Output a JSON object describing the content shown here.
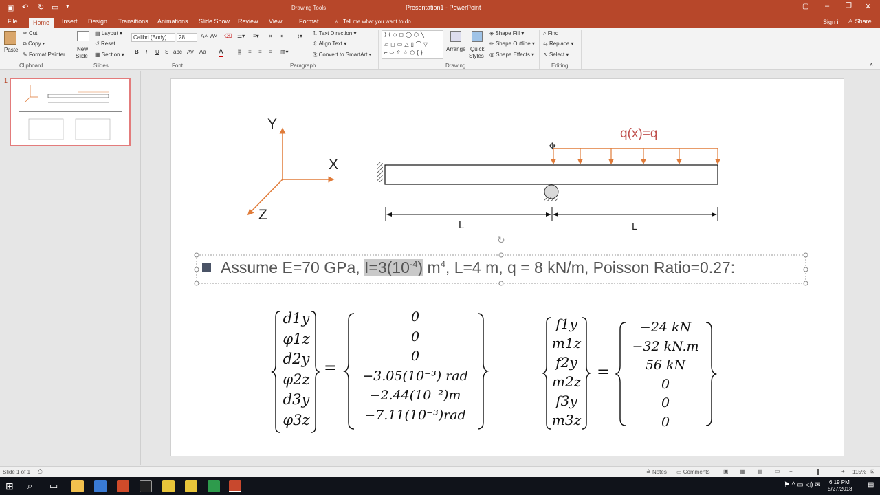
{
  "titlebar": {
    "title": "Presentation1 - PowerPoint",
    "context_label": "Drawing Tools"
  },
  "tabs": [
    "File",
    "Home",
    "Insert",
    "Design",
    "Transitions",
    "Animations",
    "Slide Show",
    "Review",
    "View",
    "Format"
  ],
  "tell_me": "Tell me what you want to do...",
  "account": {
    "signin": "Sign in",
    "share": "Share"
  },
  "ribbon": {
    "clipboard": {
      "label": "Clipboard",
      "paste": "Paste",
      "cut": "Cut",
      "copy": "Copy",
      "format_painter": "Format Painter"
    },
    "slides": {
      "label": "Slides",
      "new_slide": "New",
      "new_slide2": "Slide",
      "layout": "Layout",
      "reset": "Reset",
      "section": "Section"
    },
    "font": {
      "label": "Font",
      "font_name": "Calibri (Body)",
      "font_size": "28"
    },
    "paragraph": {
      "label": "Paragraph",
      "text_direction": "Text Direction",
      "align_text": "Align Text",
      "convert": "Convert to SmartArt"
    },
    "drawing": {
      "label": "Drawing",
      "arrange": "Arrange",
      "quick_styles": "Quick",
      "quick_styles2": "Styles",
      "shape_fill": "Shape Fill",
      "shape_outline": "Shape Outline",
      "shape_effects": "Shape Effects"
    },
    "editing": {
      "label": "Editing",
      "find": "Find",
      "replace": "Replace",
      "select": "Select"
    }
  },
  "thumbnail": {
    "number": "1"
  },
  "slide": {
    "axes": {
      "y": "Y",
      "x": "X",
      "z": "Z"
    },
    "load_label": "q(x)=q",
    "dim_left": "L",
    "dim_right": "L",
    "bullet_text_pre": "Assume E=70 GPa, ",
    "bullet_text_highlight": "I=3(10",
    "bullet_exp_highlight": "-4",
    "bullet_text_highlight_end": ")",
    "bullet_text_mid": " m",
    "bullet_exp": "4",
    "bullet_text_post": ", L=4 m, q = 8 kN/m, Poisson Ratio=0.27:",
    "eq1_lhs": [
      "d1y",
      "φ1z",
      "d2y",
      "φ2z",
      "d3y",
      "φ3z"
    ],
    "eq1_rhs": [
      "0",
      "0",
      "0",
      "−3.05(10⁻³) rad",
      "−2.44(10⁻²)m",
      "−7.11(10⁻³)rad"
    ],
    "eq2_lhs": [
      "f1y",
      "m1z",
      "f2y",
      "m2z",
      "f3y",
      "m3z"
    ],
    "eq2_rhs": [
      "−24 kN",
      "−32 kN.m",
      "56 kN",
      "0",
      "0",
      "0"
    ],
    "equals": "="
  },
  "status": {
    "slide_info": "Slide 1 of 1",
    "notes": "Notes",
    "comments": "Comments",
    "zoom": "115%"
  },
  "taskbar": {
    "time": "6:19 PM",
    "date": "5/27/2018"
  },
  "colors": {
    "accent": "#b7472a",
    "load": "#c0504d",
    "arrow": "#e07b39"
  }
}
